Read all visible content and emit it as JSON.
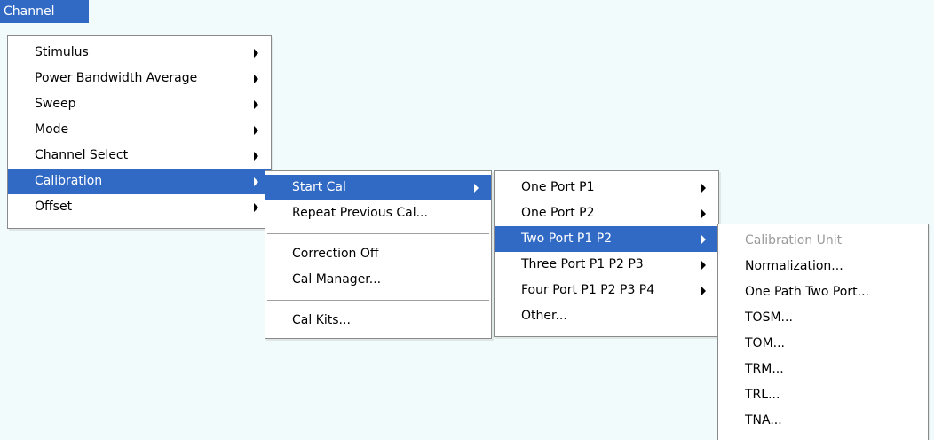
{
  "menubar": {
    "title": "Channel"
  },
  "channel_menu": {
    "items": [
      {
        "label": "Stimulus"
      },
      {
        "label": "Power Bandwidth Average"
      },
      {
        "label": "Sweep"
      },
      {
        "label": "Mode"
      },
      {
        "label": "Channel Select"
      },
      {
        "label": "Calibration"
      },
      {
        "label": "Offset"
      }
    ]
  },
  "calibration_menu": {
    "start_cal": "Start Cal",
    "repeat_previous": "Repeat Previous Cal...",
    "correction_off": "Correction Off",
    "cal_manager": "Cal Manager...",
    "cal_kits": "Cal Kits..."
  },
  "start_cal_menu": {
    "items": [
      {
        "label": "One Port P1"
      },
      {
        "label": "One Port P2"
      },
      {
        "label": "Two Port P1 P2"
      },
      {
        "label": "Three Port P1 P2 P3"
      },
      {
        "label": "Four Port P1 P2 P3 P4"
      },
      {
        "label": "Other..."
      }
    ]
  },
  "two_port_menu": {
    "items": [
      {
        "label": "Calibration Unit"
      },
      {
        "label": "Normalization..."
      },
      {
        "label": "One Path Two Port..."
      },
      {
        "label": "TOSM..."
      },
      {
        "label": "TOM..."
      },
      {
        "label": "TRM..."
      },
      {
        "label": "TRL..."
      },
      {
        "label": "TNA..."
      }
    ]
  }
}
